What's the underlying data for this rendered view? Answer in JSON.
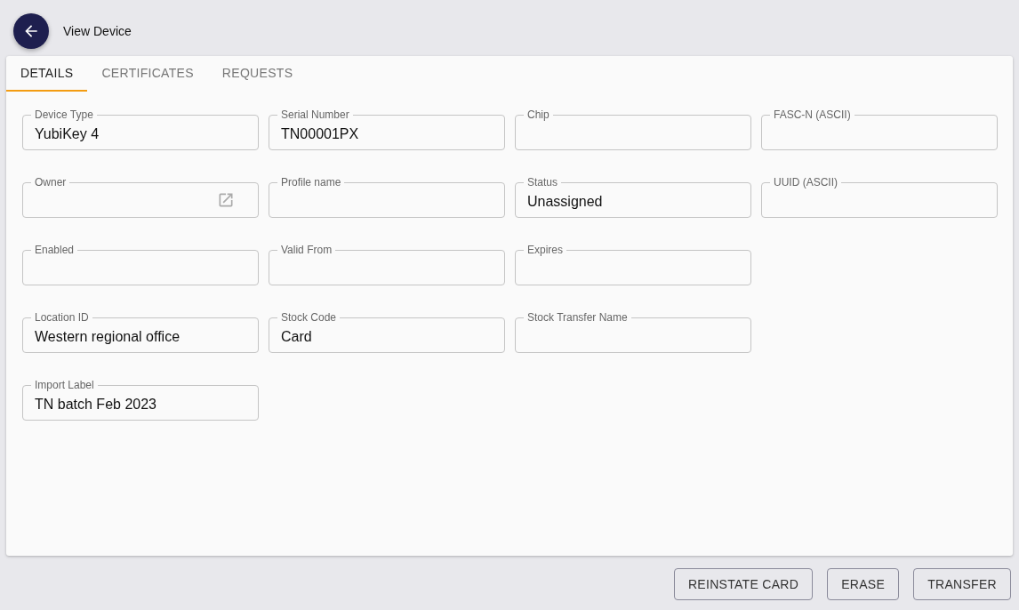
{
  "header": {
    "title": "View Device"
  },
  "tabs": [
    {
      "label": "DETAILS",
      "selected": true
    },
    {
      "label": "CERTIFICATES",
      "selected": false
    },
    {
      "label": "REQUESTS",
      "selected": false
    }
  ],
  "field_rows": [
    [
      {
        "label": "Device Type",
        "value": "YubiKey 4",
        "kind": "text"
      },
      {
        "label": "Serial Number",
        "value": "TN00001PX",
        "kind": "text"
      },
      {
        "label": "Chip",
        "kind": "text"
      },
      {
        "label": "FASC-N (ASCII)",
        "kind": "text"
      }
    ],
    [
      {
        "label": "Owner",
        "kind": "link"
      },
      {
        "label": "Profile name",
        "kind": "text"
      },
      {
        "label": "Status",
        "value": "Unassigned",
        "kind": "text"
      },
      {
        "label": "UUID (ASCII)",
        "kind": "text"
      }
    ],
    [
      {
        "label": "Enabled",
        "kind": "text"
      },
      {
        "label": "Valid From",
        "kind": "text"
      },
      {
        "label": "Expires",
        "kind": "text"
      }
    ],
    [
      {
        "label": "Location ID",
        "value": "Western regional office",
        "kind": "text"
      },
      {
        "label": "Stock Code",
        "value": "Card",
        "kind": "text"
      },
      {
        "label": "Stock Transfer Name",
        "kind": "text"
      }
    ],
    [
      {
        "label": "Import Label",
        "value": "TN batch Feb 2023",
        "kind": "text"
      }
    ]
  ],
  "buttons": [
    "REINSTATE CARD",
    "ERASE",
    "TRANSFER"
  ]
}
